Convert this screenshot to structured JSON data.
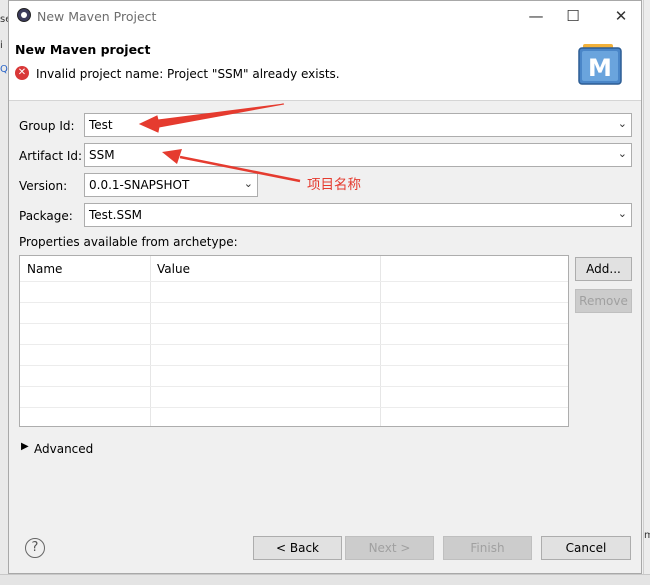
{
  "window": {
    "title": "New Maven Project"
  },
  "header": {
    "title": "New Maven project",
    "error_message": "Invalid project name: Project \"SSM\" already exists."
  },
  "form": {
    "group_id_label": "Group Id:",
    "group_id_value": "Test",
    "artifact_id_label": "Artifact Id:",
    "artifact_id_value": "SSM",
    "version_label": "Version:",
    "version_value": "0.0.1-SNAPSHOT",
    "package_label": "Package:",
    "package_value": "Test.SSM",
    "properties_label": "Properties available from archetype:"
  },
  "table": {
    "columns": [
      "Name",
      "Value"
    ]
  },
  "side_buttons": {
    "add": "Add...",
    "remove": "Remove"
  },
  "advanced_label": "Advanced",
  "footer": {
    "back": "< Back",
    "next": "Next >",
    "finish": "Finish",
    "cancel": "Cancel"
  },
  "annotation": {
    "text": "项目名称",
    "color": "#e53b2f"
  },
  "background": {
    "left_fragments": [
      "se",
      "i",
      "Q"
    ],
    "right_fragment": "mi"
  }
}
